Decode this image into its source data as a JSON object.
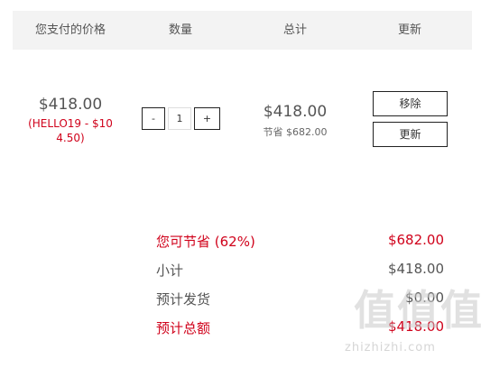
{
  "table_header": {
    "price": "您支付的价格",
    "quantity": "数量",
    "total": "总计",
    "update": "更新"
  },
  "item": {
    "price": "$418.00",
    "coupon": "(HELLO19 - $104.50)",
    "quantity_minus": "-",
    "quantity_value": "1",
    "quantity_plus": "+",
    "total": "$418.00",
    "saved": "节省 $682.00",
    "remove_label": "移除",
    "update_label": "更新"
  },
  "summary": {
    "savings_label": "您可节省 (62%)",
    "savings_value": "$682.00",
    "subtotal_label": "小计",
    "subtotal_value": "$418.00",
    "shipping_label": "预计发货",
    "shipping_value": "$0.00",
    "grand_total_label": "预计总额",
    "grand_total_value": "$418.00"
  },
  "watermark": {
    "logo": "值值值",
    "url": "zhizhizhi.com"
  },
  "colors": {
    "accent_red": "#d0021b",
    "header_bg": "#f3f3f3",
    "text": "#555555"
  }
}
